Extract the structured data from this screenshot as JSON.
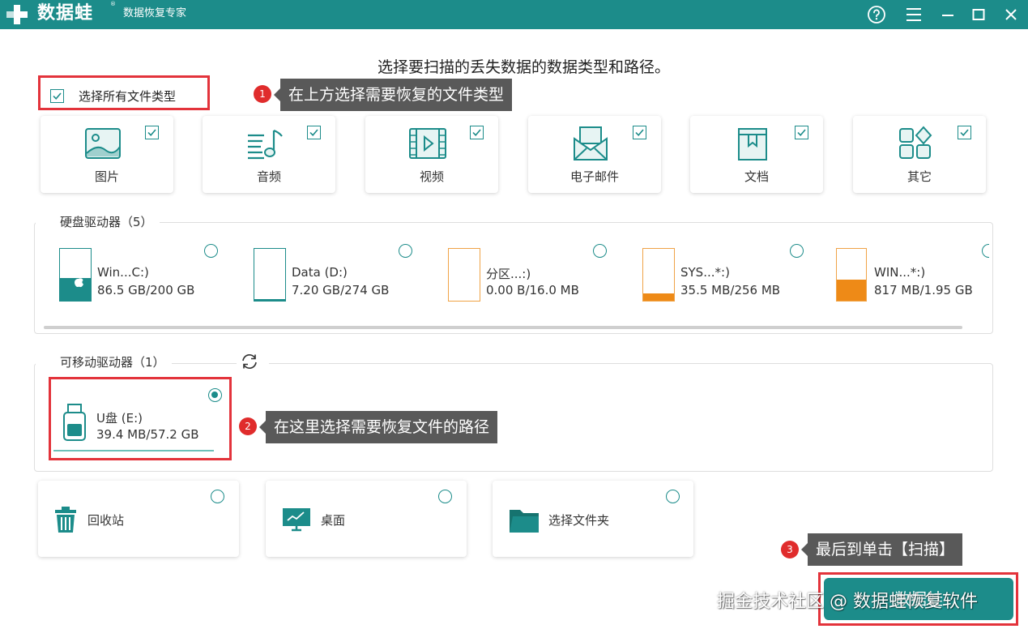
{
  "app": {
    "logo_text": "数据蛙",
    "logo_reg": "®",
    "subtitle": "数据恢复专家"
  },
  "titlebar": {
    "icons": [
      "help-icon",
      "menu-icon",
      "minimize-icon",
      "maximize-icon",
      "close-icon"
    ]
  },
  "heading": "选择要扫描的丢失数据的数据类型和路径。",
  "select_all": {
    "label": "选择所有文件类型",
    "checked": true
  },
  "file_types": [
    {
      "label": "图片",
      "icon": "image-icon",
      "checked": true
    },
    {
      "label": "音频",
      "icon": "music-icon",
      "checked": true
    },
    {
      "label": "视频",
      "icon": "video-icon",
      "checked": true
    },
    {
      "label": "电子邮件",
      "icon": "mail-icon",
      "checked": true
    },
    {
      "label": "文档",
      "icon": "document-icon",
      "checked": true
    },
    {
      "label": "其它",
      "icon": "other-icon",
      "checked": true
    }
  ],
  "hard_drives": {
    "title": "硬盘驱动器（5）",
    "drives": [
      {
        "name": "Win...C:)",
        "size": "86.5 GB/200 GB",
        "used_fraction": 0.43,
        "color": "#1c8c8a",
        "os_icon": "apple-icon"
      },
      {
        "name": "Data (D:)",
        "size": "7.20 GB/274 GB",
        "used_fraction": 0.03,
        "color": "#1c8c8a"
      },
      {
        "name": "分区...:)",
        "size": "0.00  B/16.0 MB",
        "used_fraction": 0.0,
        "color": "#ee8a17"
      },
      {
        "name": "SYS...*:)",
        "size": "35.5 MB/256 MB",
        "used_fraction": 0.14,
        "color": "#ee8a17"
      },
      {
        "name": "WIN...*:)",
        "size": "817 MB/1.95 GB",
        "used_fraction": 0.41,
        "color": "#ee8a17"
      }
    ]
  },
  "removable": {
    "title": "可移动驱动器（1）",
    "refresh_icon": "refresh-icon",
    "drive": {
      "name": "U盘 (E:)",
      "size": "39.4 MB/57.2 GB",
      "selected": true
    }
  },
  "locations": [
    {
      "label": "回收站",
      "icon": "trash-icon"
    },
    {
      "label": "桌面",
      "icon": "desktop-icon"
    },
    {
      "label": "选择文件夹",
      "icon": "folder-icon"
    }
  ],
  "callouts": [
    {
      "num": "1",
      "text": "在上方选择需要恢复的文件类型"
    },
    {
      "num": "2",
      "text": "在这里选择需要恢复文件的路径"
    },
    {
      "num": "3",
      "text": "最后到单击【扫描】"
    }
  ],
  "scan_button": "数据蛙",
  "watermark": "掘金技术社区 @ 数据蛙恢复软件",
  "colors": {
    "accent": "#1c8c8a",
    "orange": "#ee8a17",
    "highlight": "#e3333b",
    "callout": "#595959"
  }
}
